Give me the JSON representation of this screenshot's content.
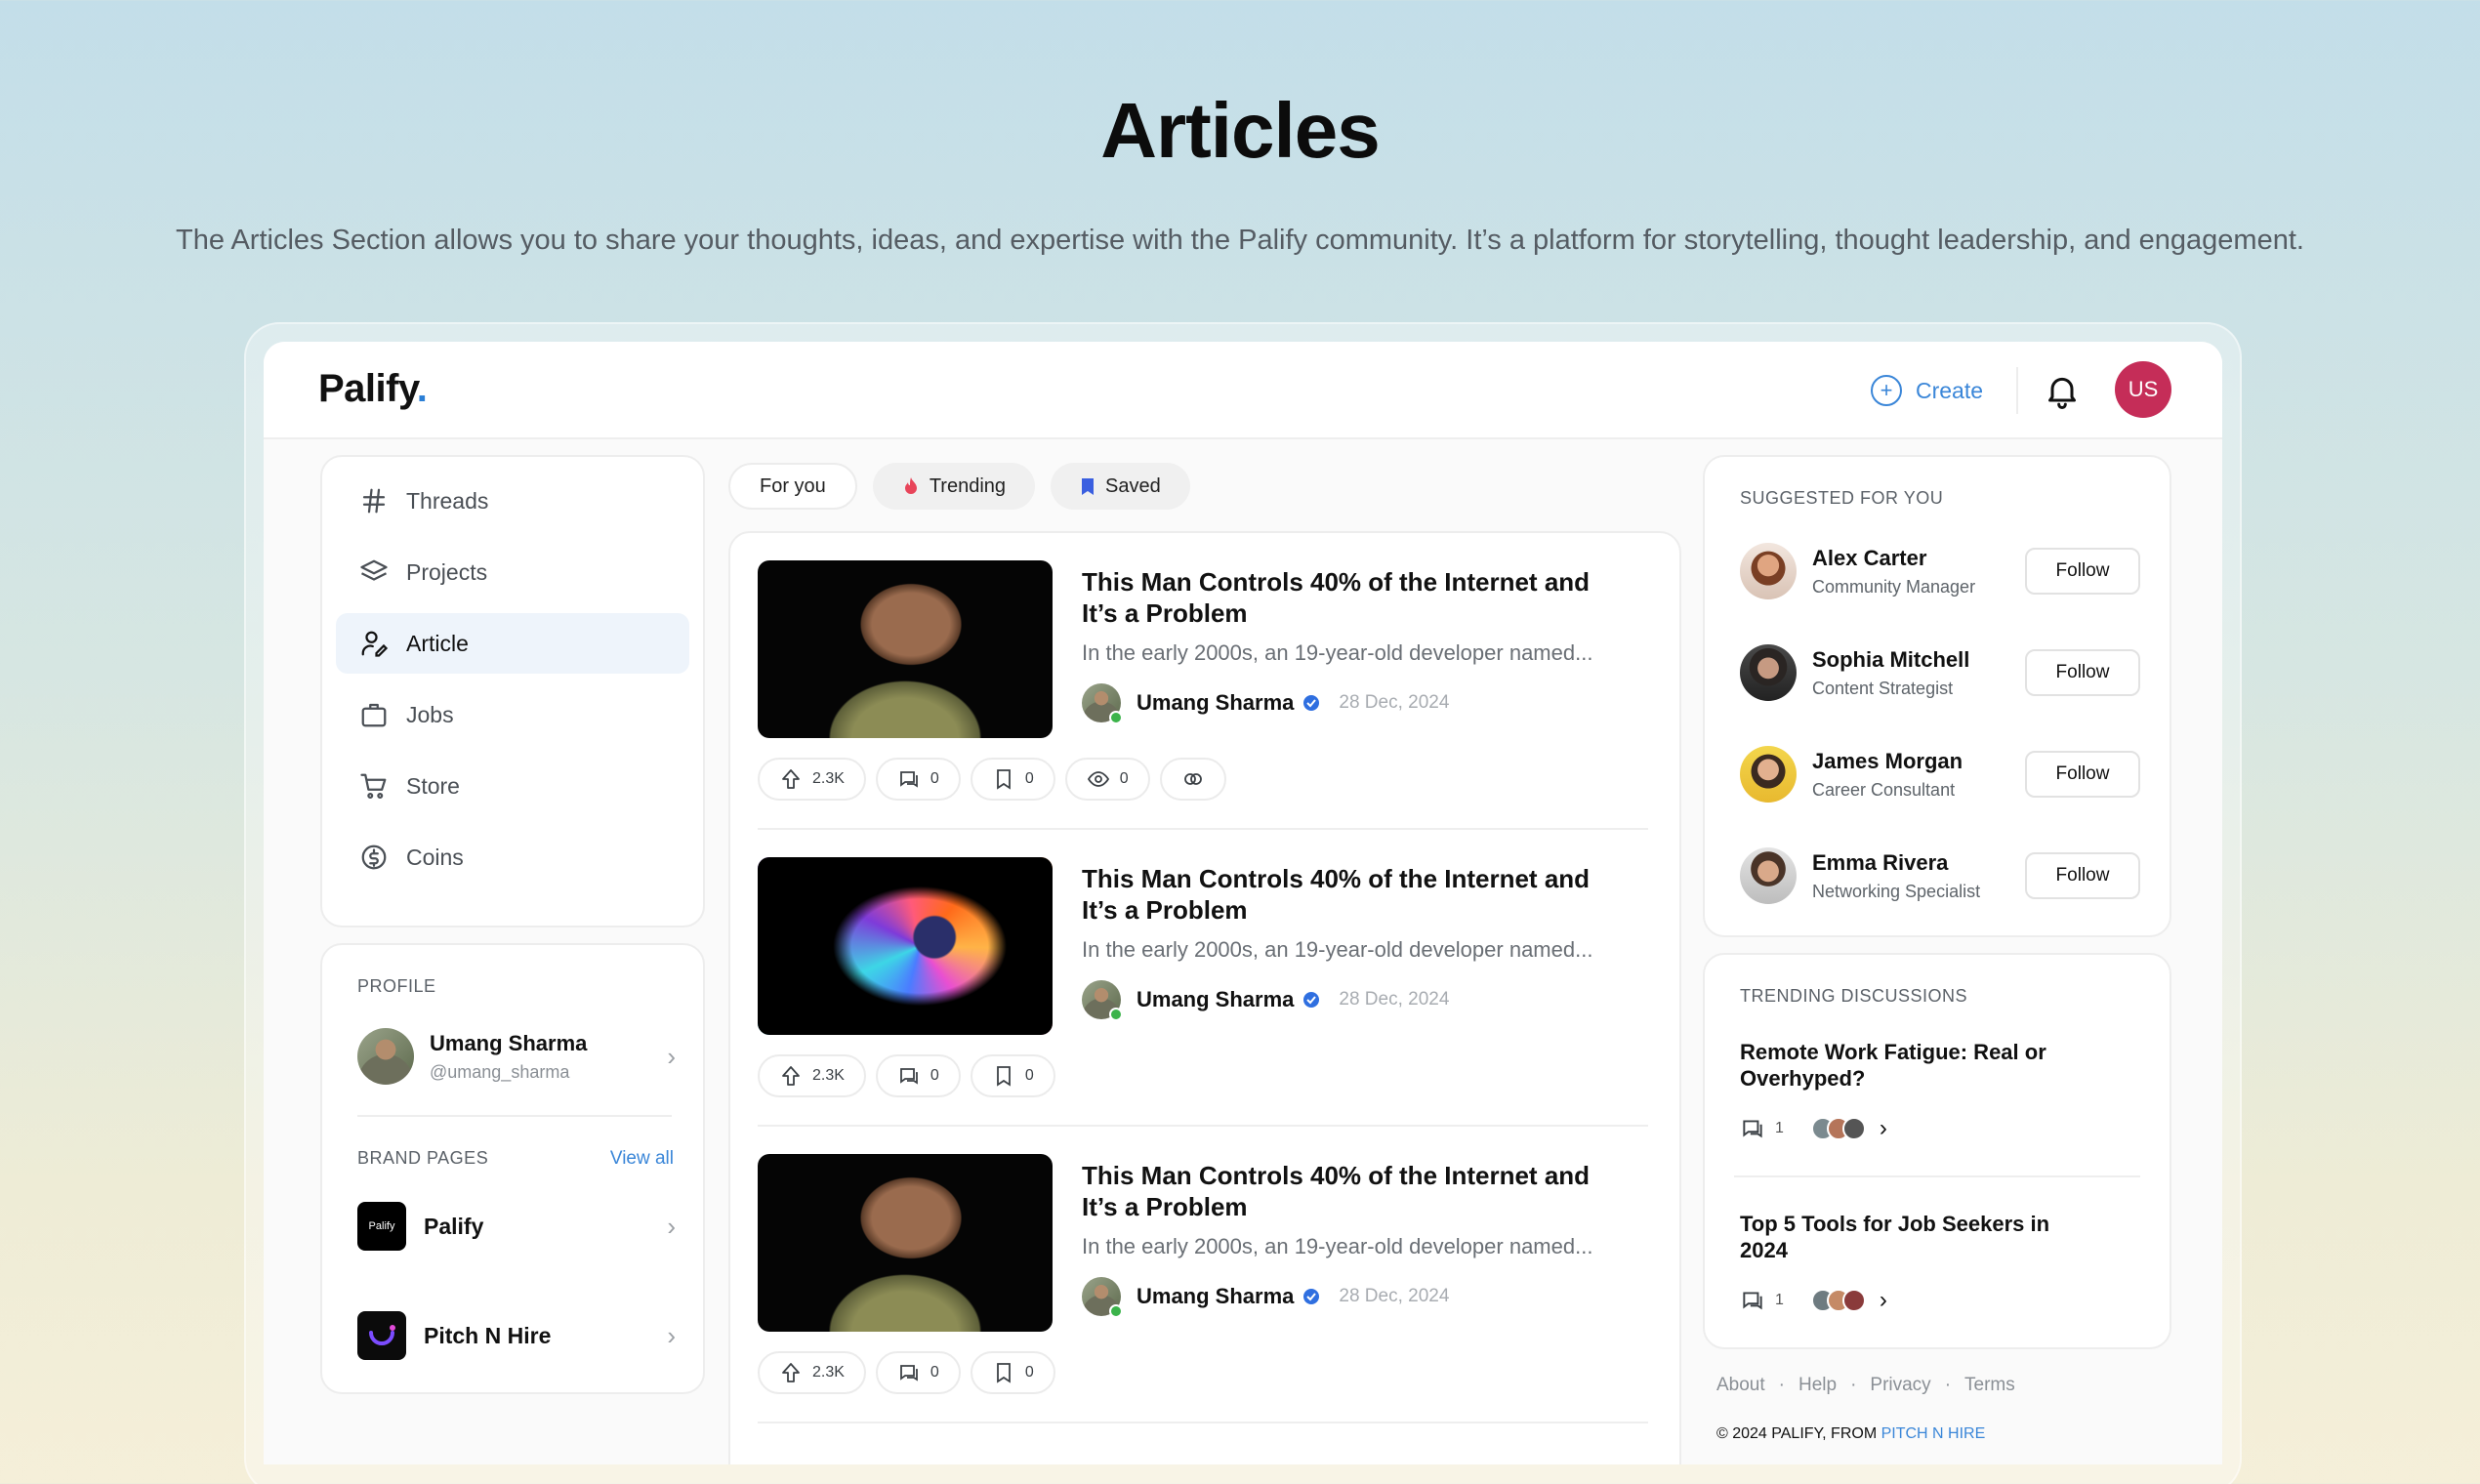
{
  "hero": {
    "title": "Articles",
    "subtitle": "The Articles Section allows you to share your thoughts, ideas, and expertise with the Palify community. It’s a platform for storytelling, thought leadership, and engagement."
  },
  "header": {
    "logo_text": "Palify",
    "logo_dot": ".",
    "create_label": "Create",
    "avatar_initials": "US",
    "avatar_color": "#c52d58"
  },
  "sidebar": {
    "items": [
      {
        "label": "Threads",
        "icon": "hash-icon"
      },
      {
        "label": "Projects",
        "icon": "layers-icon"
      },
      {
        "label": "Article",
        "icon": "user-edit-icon",
        "active": true
      },
      {
        "label": "Jobs",
        "icon": "briefcase-icon"
      },
      {
        "label": "Store",
        "icon": "cart-icon"
      },
      {
        "label": "Coins",
        "icon": "coin-icon"
      }
    ]
  },
  "profile": {
    "section_label": "PROFILE",
    "name": "Umang Sharma",
    "handle": "@umang_sharma",
    "brand_label": "BRAND PAGES",
    "view_all": "View all",
    "brands": [
      {
        "name": "Palify",
        "logo_text": "Palify"
      },
      {
        "name": "Pitch N Hire",
        "logo_text": ""
      }
    ]
  },
  "tabs": [
    {
      "label": "For you",
      "active": true
    },
    {
      "label": "Trending",
      "icon": "fire-icon"
    },
    {
      "label": "Saved",
      "icon": "bookmark-icon"
    }
  ],
  "posts": [
    {
      "title": "This Man Controls 40% of the Internet and It’s a Problem",
      "excerpt": "In the early 2000s, an 19-year-old developer named...",
      "author": "Umang Sharma",
      "date": "28 Dec, 2024",
      "upvotes": "2.3K",
      "comments": "0",
      "saves": "0",
      "views": "0"
    },
    {
      "title": "This Man Controls 40% of the Internet and It’s a Problem",
      "excerpt": "In the early 2000s, an 19-year-old developer named...",
      "author": "Umang Sharma",
      "date": "28 Dec, 2024",
      "upvotes": "2.3K",
      "comments": "0",
      "saves": "0"
    },
    {
      "title": "This Man Controls 40% of the Internet and It’s a Problem",
      "excerpt": "In the early 2000s, an 19-year-old developer named...",
      "author": "Umang Sharma",
      "date": "28 Dec, 2024",
      "upvotes": "2.3K",
      "comments": "0",
      "saves": "0"
    }
  ],
  "suggested": {
    "label": "SUGGESTED FOR YOU",
    "follow_label": "Follow",
    "people": [
      {
        "name": "Alex Carter",
        "role": "Community Manager"
      },
      {
        "name": "Sophia Mitchell",
        "role": "Content Strategist"
      },
      {
        "name": "James Morgan",
        "role": "Career Consultant"
      },
      {
        "name": "Emma Rivera",
        "role": "Networking Specialist"
      }
    ]
  },
  "trending": {
    "label": "TRENDING DISCUSSIONS",
    "items": [
      {
        "title": "Remote Work Fatigue: Real or Overhyped?",
        "comments": "1"
      },
      {
        "title": "Top 5 Tools for Job Seekers in 2024",
        "comments": "1"
      }
    ]
  },
  "footer": {
    "links": [
      "About",
      "Help",
      "Privacy",
      "Terms"
    ],
    "separator": "·",
    "copyright_prefix": "© 2024 PALIFY, FROM ",
    "copyright_brand": "PITCH N HIRE"
  },
  "colors": {
    "accent": "#3a86d8",
    "verified": "#2f6fe0",
    "online": "#3bb34a"
  }
}
